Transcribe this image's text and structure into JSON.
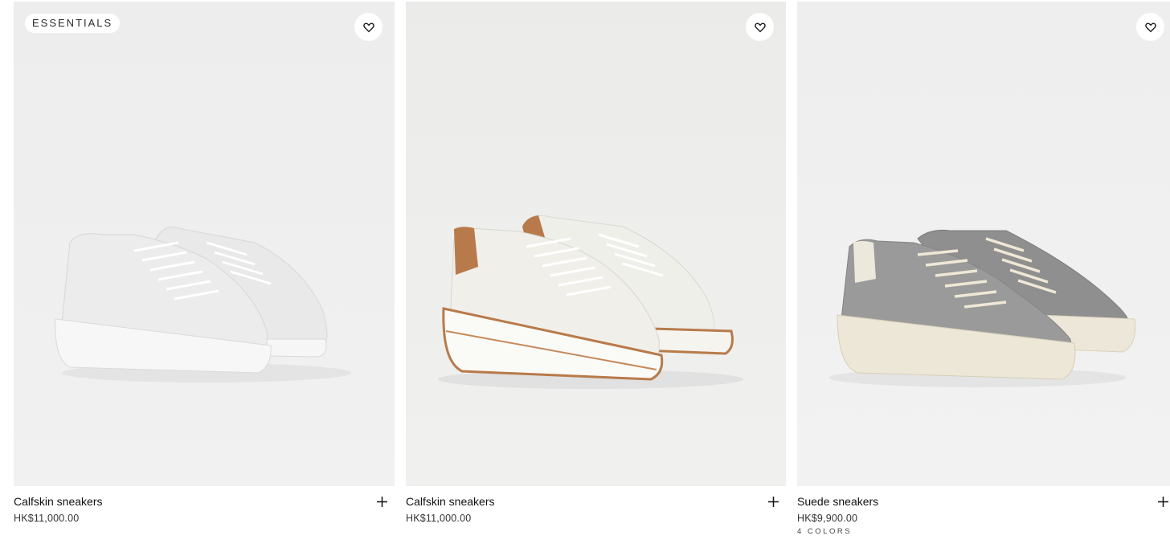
{
  "products": [
    {
      "badge": "ESSENTIALS",
      "name": "Calfskin sneakers",
      "price": "HK$11,000.00",
      "image_icon": "white-calfskin-sneakers-image",
      "favorite_icon": "heart-outline-icon",
      "add_icon": "plus-icon"
    },
    {
      "name": "Calfskin sneakers",
      "price": "HK$11,000.00",
      "image_icon": "white-tan-calfskin-sneakers-image",
      "favorite_icon": "heart-outline-icon",
      "add_icon": "plus-icon"
    },
    {
      "name": "Suede sneakers",
      "price": "HK$9,900.00",
      "colors": "4 COLORS",
      "image_icon": "grey-suede-sneakers-image",
      "favorite_icon": "heart-outline-icon",
      "add_icon": "plus-icon"
    }
  ],
  "colors": {
    "background": "#ffffff",
    "image_background": "#eeeeee",
    "text": "#111111"
  }
}
